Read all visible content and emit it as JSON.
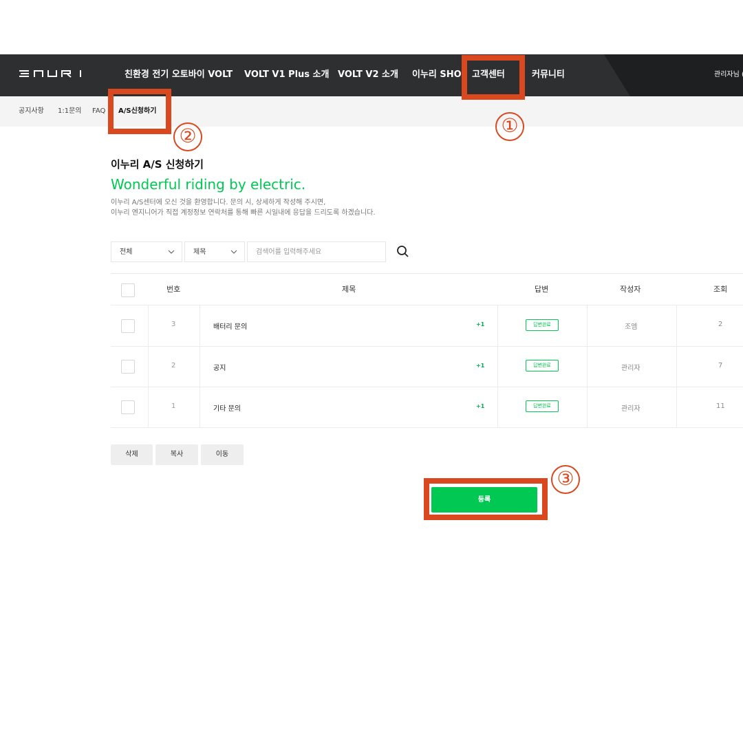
{
  "header": {
    "logo_text": "ENURI",
    "nav": [
      "친환경 전기 오토바이 VOLT",
      "VOLT V1 Plus 소개",
      "VOLT V2 소개",
      "이누리 SHOP",
      "고객센터",
      "커뮤니티"
    ],
    "admin_label": "관리자님 (",
    "bg_color": "#2e2f31"
  },
  "subnav": {
    "items": [
      "공지사항",
      "1:1문의",
      "FAQ",
      "A/S신청하기"
    ],
    "active_index": 3
  },
  "annotations": {
    "color": "#d9481e",
    "numbers": [
      "①",
      "②",
      "③"
    ]
  },
  "page": {
    "title": "이누리 A/S 신청하기",
    "slogan": "Wonderful riding by electric.",
    "desc_line1": "이누리 A/S센터에 오신 것을 환영합니다. 문의 시, 상세하게 작성해 주시면,",
    "desc_line2": "이누리 엔지니어가 직접 계정정보 연락처를 통해 빠른 시일내에 응답을 드리도록 하겠습니다.",
    "accent_color": "#00c853"
  },
  "search": {
    "category_select": "전체",
    "field_select": "제목",
    "placeholder": "검색어를 입력해주세요",
    "value": "",
    "icon": "search-icon"
  },
  "table": {
    "headers": [
      "번호",
      "제목",
      "답변",
      "작성자",
      "조회"
    ],
    "rows": [
      {
        "no": "3",
        "subject": "배터리 문의",
        "comment_count": "+1",
        "status": "답변완료",
        "writer": "조엠",
        "views": "2"
      },
      {
        "no": "2",
        "subject": "공지",
        "comment_count": "+1",
        "status": "답변완료",
        "writer": "관리자",
        "views": "7"
      },
      {
        "no": "1",
        "subject": "기타 문의",
        "comment_count": "+1",
        "status": "답변완료",
        "writer": "관리자",
        "views": "11"
      }
    ]
  },
  "actions": {
    "delete_label": "삭제",
    "copy_label": "복사",
    "move_label": "이동",
    "register_label": "등록"
  }
}
